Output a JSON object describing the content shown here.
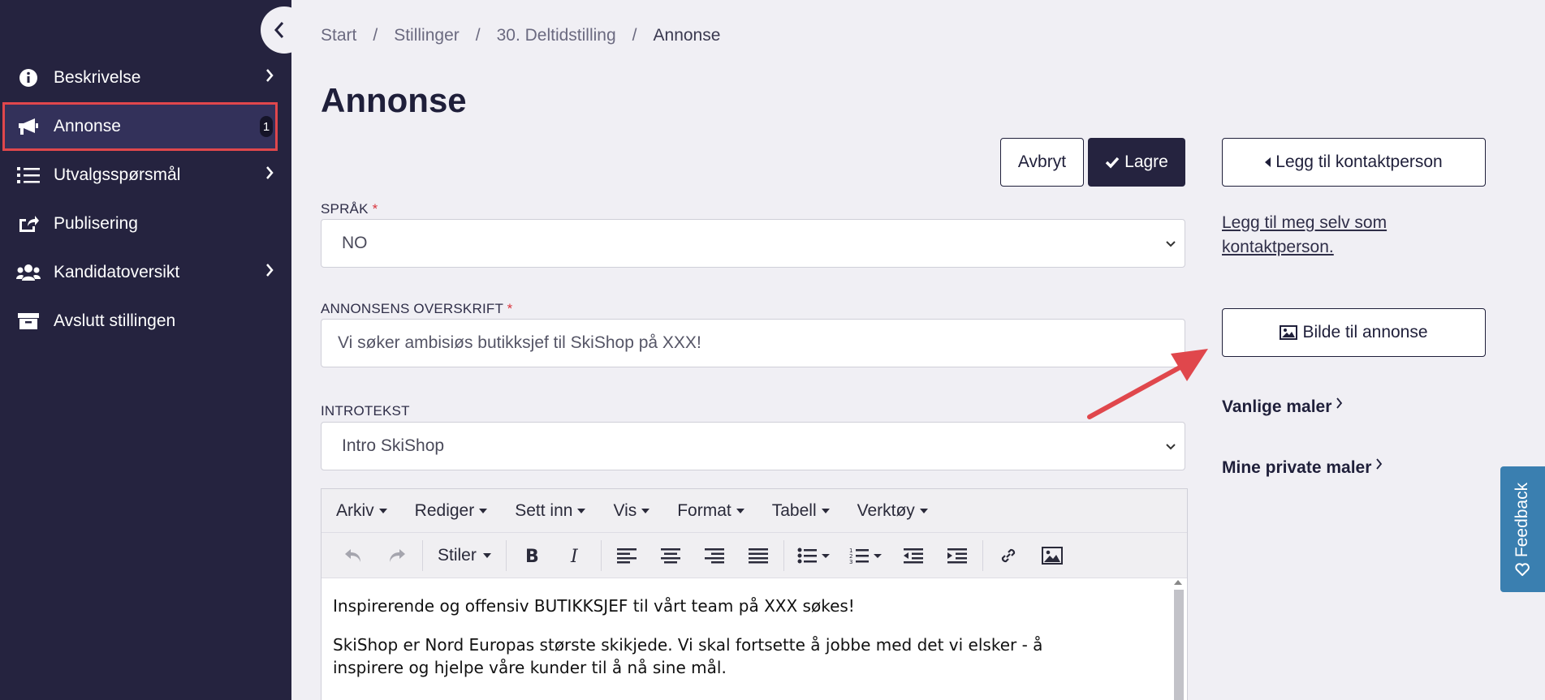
{
  "sidebar": {
    "items": [
      {
        "label": "Beskrivelse",
        "icon": "info-icon",
        "has_chevron": true
      },
      {
        "label": "Annonse",
        "icon": "megaphone-icon",
        "badge": "1",
        "active": true
      },
      {
        "label": "Utvalgsspørsmål",
        "icon": "list-icon",
        "has_chevron": true
      },
      {
        "label": "Publisering",
        "icon": "share-icon"
      },
      {
        "label": "Kandidatoversikt",
        "icon": "users-icon",
        "has_chevron": true
      },
      {
        "label": "Avslutt stillingen",
        "icon": "archive-icon"
      }
    ]
  },
  "breadcrumb": {
    "items": [
      "Start",
      "Stillinger",
      "30. Deltidstilling",
      "Annonse"
    ],
    "separator": "/"
  },
  "page": {
    "title": "Annonse"
  },
  "actions": {
    "cancel_label": "Avbryt",
    "save_label": "Lagre"
  },
  "form": {
    "language": {
      "label": "SPRÅK",
      "required_mark": "*",
      "value": "NO"
    },
    "headline": {
      "label": "ANNONSENS OVERSKRIFT",
      "required_mark": "*",
      "value": "Vi søker ambisiøs butikksjef til SkiShop på XXX!"
    },
    "intro": {
      "label": "INTROTEKST",
      "value": "Intro SkiShop"
    }
  },
  "editor": {
    "menus": [
      "Arkiv",
      "Rediger",
      "Sett inn",
      "Vis",
      "Format",
      "Tabell",
      "Verktøy"
    ],
    "styles_label": "Stiler",
    "paragraphs": [
      "Inspirerende og offensiv BUTIKKSJEF til vårt team på XXX søkes!",
      "SkiShop er Nord Europas største skikjede. Vi skal fortsette å jobbe med det vi elsker - å inspirere og hjelpe våre kunder til å nå sine mål."
    ]
  },
  "right_panel": {
    "add_contact_label": "Legg til kontaktperson",
    "add_self_label": "Legg til meg selv som kontaktperson.",
    "image_label": "Bilde til annonse",
    "common_templates_label": "Vanlige maler",
    "private_templates_label": "Mine private maler"
  },
  "feedback": {
    "label": "Feedback"
  },
  "colors": {
    "sidebar_bg": "#25233f",
    "page_bg": "#f0eff4",
    "highlight": "#e0474c",
    "feedback_bg": "#3a7fb0"
  }
}
